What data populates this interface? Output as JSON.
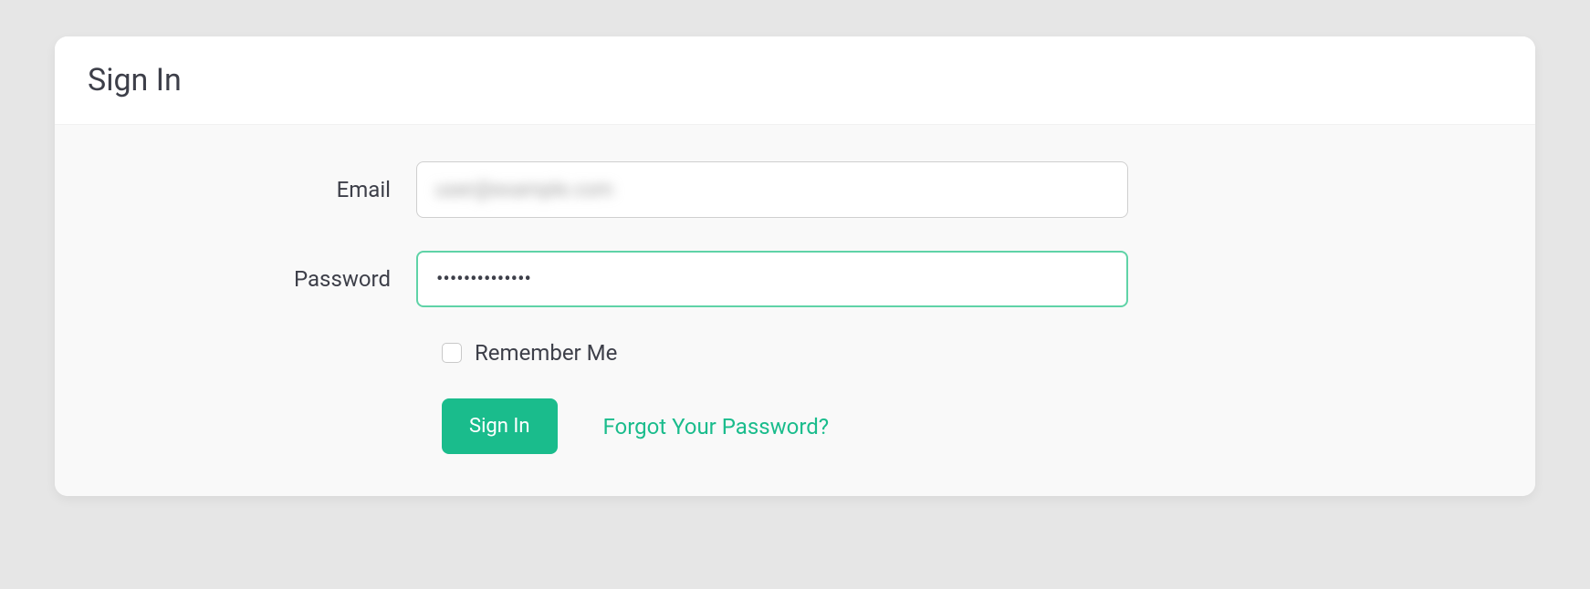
{
  "header": {
    "title": "Sign In"
  },
  "form": {
    "email": {
      "label": "Email",
      "value": "user@example.com"
    },
    "password": {
      "label": "Password",
      "value": "••••••••••••••"
    },
    "remember": {
      "label": "Remember Me",
      "checked": false
    },
    "submit_label": "Sign In",
    "forgot_label": "Forgot Your Password?"
  },
  "colors": {
    "accent": "#1abc8c",
    "focus_border": "#5fd3a7"
  }
}
